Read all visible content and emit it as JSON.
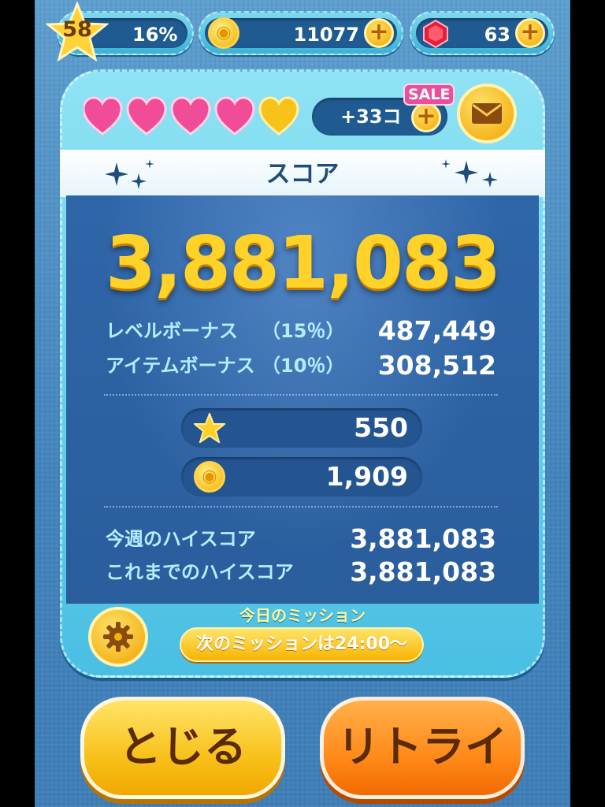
{
  "top_bar": {
    "level": "58",
    "progress_text": "16%",
    "progress_pct": 16,
    "coins": "11077",
    "gems": "63"
  },
  "lives": {
    "hearts_full": 4,
    "hearts_total": 5,
    "count_text": "+33コ",
    "sale_badge": "SALE"
  },
  "score_panel": {
    "title": "スコア",
    "score": "3,881,083",
    "level_bonus": {
      "label": "レベルボーナス",
      "percent": "（15％）",
      "value": "487,449"
    },
    "item_bonus": {
      "label": "アイテムボーナス",
      "percent": "（10％）",
      "value": "308,512"
    },
    "reward_stars": "550",
    "reward_coins": "1,909",
    "weekly_high_label": "今週のハイスコア",
    "weekly_high_value": "3,881,083",
    "alltime_high_label": "これまでのハイスコア",
    "alltime_high_value": "3,881,083"
  },
  "mission": {
    "label": "今日のミッション",
    "next_text": "次のミッションは24:00〜"
  },
  "buttons": {
    "close": "とじる",
    "retry": "リトライ"
  },
  "colors": {
    "score_gold": "#ffd22a",
    "bonus_label": "#b5ecff",
    "panel_blue": "#2f66a8",
    "heart_pink": "#f04c97",
    "heart_gold": "#f7c21a"
  },
  "icons": [
    "star-icon",
    "plus-icon",
    "coin-icon",
    "gem-icon",
    "heart-icon",
    "mail-icon",
    "gear-icon",
    "sparkle-icon"
  ]
}
